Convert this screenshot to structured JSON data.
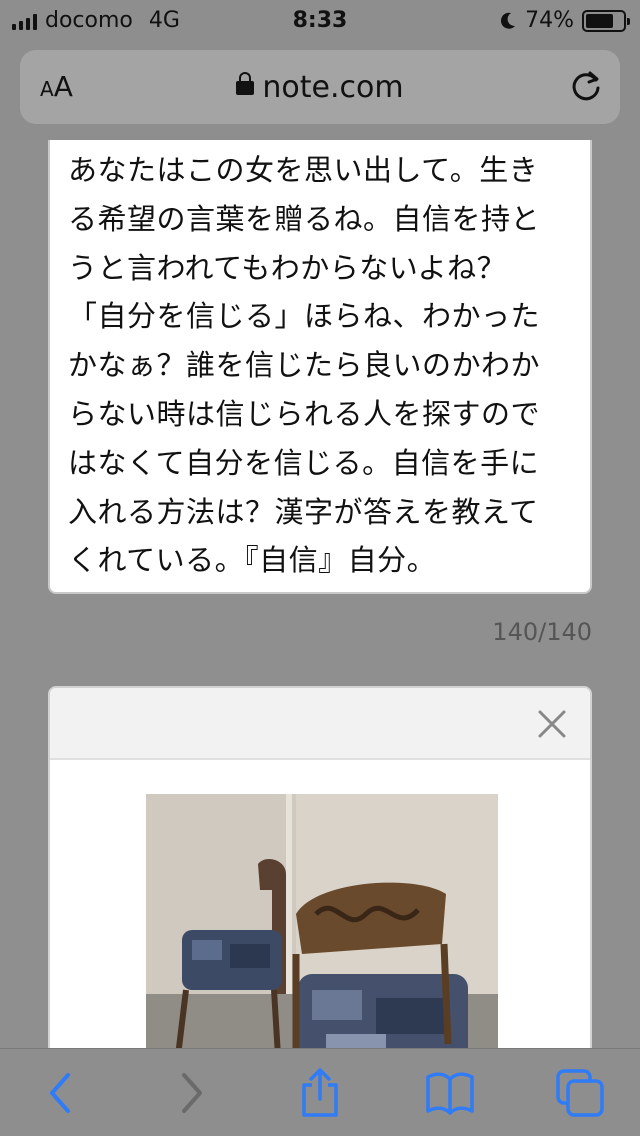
{
  "status_bar": {
    "carrier": "docomo",
    "network": "4G",
    "time": "8:33",
    "battery_percent": "74%",
    "battery_level": 0.74
  },
  "address_bar": {
    "text_size_label_small": "A",
    "text_size_label_large": "A",
    "url": "note.com",
    "icons": [
      "lock-icon",
      "reload-icon"
    ]
  },
  "article": {
    "body_text": "あなたはこの女を思い出して。生きる希望の言葉を贈るね。自信を持とうと言われてもわからないよね？「自分を信じる」ほらね、わかったかなぁ？誰を信じたら良いのかわからない時は信じられる人を探すのではなくて自分を信じる。自信を手に入れる方法は？漢字が答えを教えてくれている。『自信』自分。",
    "lines": [
      "あなたはこの女を思い出して。生き",
      "る希望の言葉を贈るね。自信を持と",
      "うと言われてもわからないよね？",
      "「自分を信じる」ほらね、わかった",
      "かなぁ？誰を信じたら良いのかわか",
      "らない時は信じられる人を探すので",
      "はなくて自分を信じる。自信を手に",
      "入れる方法は？漢字が答えを教えて",
      "くれている。『自信』自分。"
    ],
    "char_counter": "140/140"
  },
  "image_card": {
    "icons": [
      "close-icon"
    ],
    "photo": "two-chairs-photo"
  },
  "bottom_toolbar": {
    "icons": [
      "back-icon",
      "forward-icon",
      "share-icon",
      "bookmarks-icon",
      "tabs-icon"
    ]
  },
  "colors": {
    "accent": "#2f7cf6",
    "dim_overlay": "#8f8f8f",
    "card_bg": "#ffffff"
  }
}
